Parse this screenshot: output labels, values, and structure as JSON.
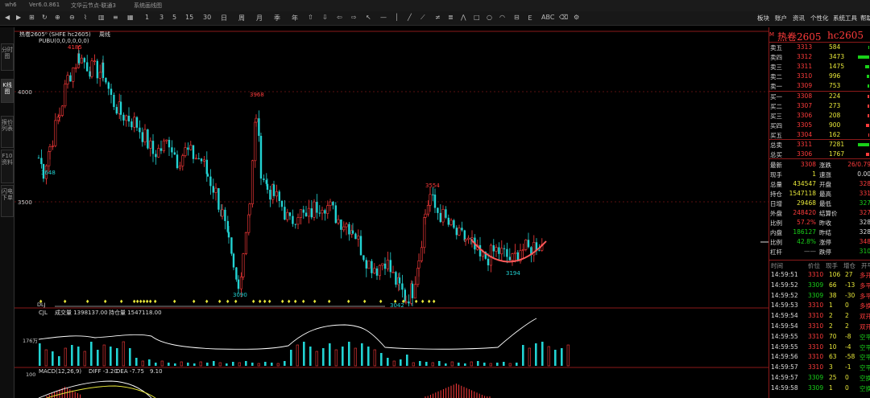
{
  "titlebar": {
    "app": "wh6",
    "version": "Ver6.0.861",
    "node": "文华云节点-联通3",
    "menu": "系统画线图"
  },
  "toolbar": {
    "periods": [
      "1",
      "3",
      "5",
      "15",
      "30",
      "日",
      "周",
      "月",
      "季",
      "年"
    ],
    "right_menu": [
      "板块",
      "账户",
      "资讯",
      "个性化",
      "系统工具",
      "帮助"
    ]
  },
  "left_tabs": [
    "分时图",
    "K线图",
    "报价列表",
    "F10资料",
    "闪电下单"
  ],
  "chart_header": {
    "symbol_line": "热卷2605⁰ (SHFE hc2605)",
    "period": "周线",
    "indicator": "PUBU(0,0,0,0,0,0)"
  },
  "main_chart": {
    "y_labels": [
      "4000",
      "3500"
    ],
    "annotations": {
      "high": "4185",
      "low_left": "3648",
      "peak_mid": "3968",
      "low_mid": "3090",
      "low_min": "3042",
      "peak_right": "3554",
      "low_right": "3194"
    }
  },
  "volume_pane": {
    "header": "CJL",
    "vol_label": "成交量 1398137.00",
    "oi_label": "持仓量 1547118.00",
    "y_label": "176万",
    "signal_label": "DLJ"
  },
  "macd_pane": {
    "header": "MACD(12,26,9)",
    "diff": "DIFF -3.20",
    "dea": "DEA -7.75",
    "macd": "9.10",
    "y_label": "100"
  },
  "quote": {
    "title": "热卷2605",
    "code": "hc2605",
    "asks": [
      {
        "label": "卖五",
        "price": "3313",
        "vol": "584"
      },
      {
        "label": "卖四",
        "price": "3312",
        "vol": "3473"
      },
      {
        "label": "卖三",
        "price": "3311",
        "vol": "1475"
      },
      {
        "label": "卖二",
        "price": "3310",
        "vol": "996"
      },
      {
        "label": "卖一",
        "price": "3309",
        "vol": "753"
      }
    ],
    "bids": [
      {
        "label": "买一",
        "price": "3308",
        "vol": "224"
      },
      {
        "label": "买二",
        "price": "3307",
        "vol": "273"
      },
      {
        "label": "买三",
        "price": "3306",
        "vol": "208"
      },
      {
        "label": "买四",
        "price": "3305",
        "vol": "900"
      },
      {
        "label": "买五",
        "price": "3304",
        "vol": "162"
      }
    ],
    "total_sell": {
      "label": "总卖",
      "price": "3311",
      "vol": "7281"
    },
    "total_buy": {
      "label": "总买",
      "price": "3306",
      "vol": "1767"
    },
    "stats_left": [
      {
        "k": "最新",
        "v": "3308"
      },
      {
        "k": "现手",
        "v": "1"
      },
      {
        "k": "总量",
        "v": "434547"
      },
      {
        "k": "持仓",
        "v": "1547118"
      },
      {
        "k": "日增",
        "v": "29468"
      },
      {
        "k": "外盘",
        "v": "248420"
      },
      {
        "k": "比例",
        "v": "57.2%"
      },
      {
        "k": "内盘",
        "v": "186127"
      },
      {
        "k": "比例",
        "v": "42.8%"
      },
      {
        "k": "杠杆",
        "v": "——"
      }
    ],
    "stats_right": [
      {
        "k": "涨跌",
        "v": "26/0.79"
      },
      {
        "k": "速涨",
        "v": "0.00"
      },
      {
        "k": "开盘",
        "v": "328"
      },
      {
        "k": "最高",
        "v": "331"
      },
      {
        "k": "最低",
        "v": "327"
      },
      {
        "k": "结算价",
        "v": "327"
      },
      {
        "k": "昨收",
        "v": "328"
      },
      {
        "k": "昨结",
        "v": "328"
      },
      {
        "k": "涨停",
        "v": "348"
      },
      {
        "k": "跌停",
        "v": "310"
      }
    ],
    "ticks_header": [
      "时间",
      "价位",
      "现手",
      "增仓",
      "开平"
    ],
    "ticks": [
      {
        "t": "14:59:51",
        "p": "3310",
        "v": "106",
        "d": "27",
        "o": "多开"
      },
      {
        "t": "14:59:52",
        "p": "3309",
        "v": "66",
        "d": "-13",
        "o": "多平"
      },
      {
        "t": "14:59:52",
        "p": "3309",
        "v": "38",
        "d": "-30",
        "o": "多平"
      },
      {
        "t": "14:59:53",
        "p": "3310",
        "v": "1",
        "d": "0",
        "o": "多换"
      },
      {
        "t": "14:59:54",
        "p": "3310",
        "v": "2",
        "d": "2",
        "o": "双开"
      },
      {
        "t": "14:59:54",
        "p": "3310",
        "v": "2",
        "d": "2",
        "o": "双开"
      },
      {
        "t": "14:59:55",
        "p": "3310",
        "v": "70",
        "d": "-8",
        "o": "空平"
      },
      {
        "t": "14:59:55",
        "p": "3310",
        "v": "10",
        "d": "-4",
        "o": "空平"
      },
      {
        "t": "14:59:56",
        "p": "3310",
        "v": "63",
        "d": "-58",
        "o": "空平"
      },
      {
        "t": "14:59:57",
        "p": "3310",
        "v": "3",
        "d": "-1",
        "o": "空平"
      },
      {
        "t": "14:59:57",
        "p": "3309",
        "v": "25",
        "d": "0",
        "o": "空换"
      },
      {
        "t": "14:59:58",
        "p": "3309",
        "v": "1",
        "d": "0",
        "o": "空换"
      }
    ]
  },
  "colors": {
    "up": "#ff3b3b",
    "down": "#22d3d3",
    "panel_border": "#8b1a1a"
  }
}
